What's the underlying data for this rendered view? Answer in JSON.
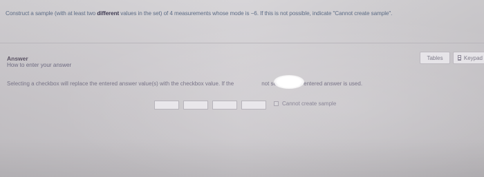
{
  "question": {
    "part1": "Construct a sample (with at least two ",
    "emphasis": "different",
    "part2": " values in the set) of 4 measurements whose mode is −6. If this is not possible, indicate \"Cannot create sample\"."
  },
  "answer": {
    "heading": "Answer",
    "how_to": "How to enter your answer"
  },
  "toolbar": {
    "tables_label": "Tables",
    "keypad_label": "Keypad"
  },
  "instruction": {
    "part1": "Selecting a checkbox will replace the entered answer value(s) with the checkbox value. If the",
    "part2": "not selected, the entered answer is used."
  },
  "inputs": {
    "values": [
      "",
      "",
      "",
      ""
    ]
  },
  "checkbox": {
    "label": "Cannot create sample",
    "checked": false
  }
}
